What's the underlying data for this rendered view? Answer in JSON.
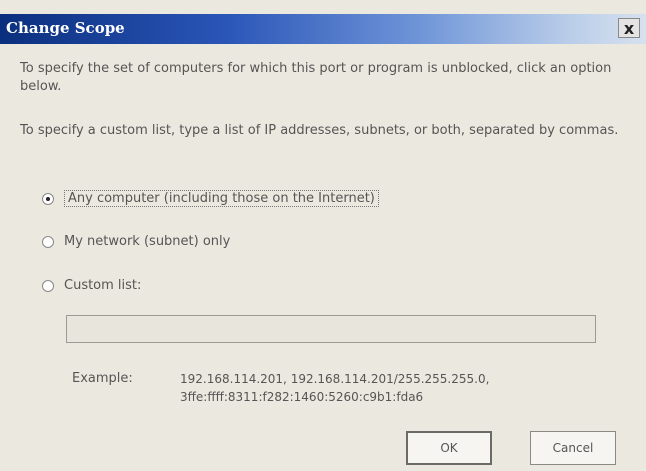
{
  "window": {
    "title": "Change Scope",
    "close_label": "x"
  },
  "intro_text": "To specify the set of computers for which this port or program is unblocked, click an option below.",
  "custom_text": "To specify a custom list, type a list of IP addresses, subnets, or both, separated by commas.",
  "options": [
    {
      "label": "Any computer (including those on the Internet)",
      "selected": true
    },
    {
      "label": "My network (subnet) only",
      "selected": false
    },
    {
      "label": "Custom list:",
      "selected": false
    }
  ],
  "custom_list": {
    "value": "",
    "example_label": "Example:",
    "example_line1": "192.168.114.201, 192.168.114.201/255.255.255.0,",
    "example_line2": "3ffe:ffff:8311:f282:1460:5260:c9b1:fda6"
  },
  "buttons": {
    "ok": "OK",
    "cancel": "Cancel"
  },
  "colors": {
    "titlebar_start": "#0b2f7e",
    "titlebar_end": "#d7e1ee",
    "dialog_bg": "#ebe9df"
  }
}
